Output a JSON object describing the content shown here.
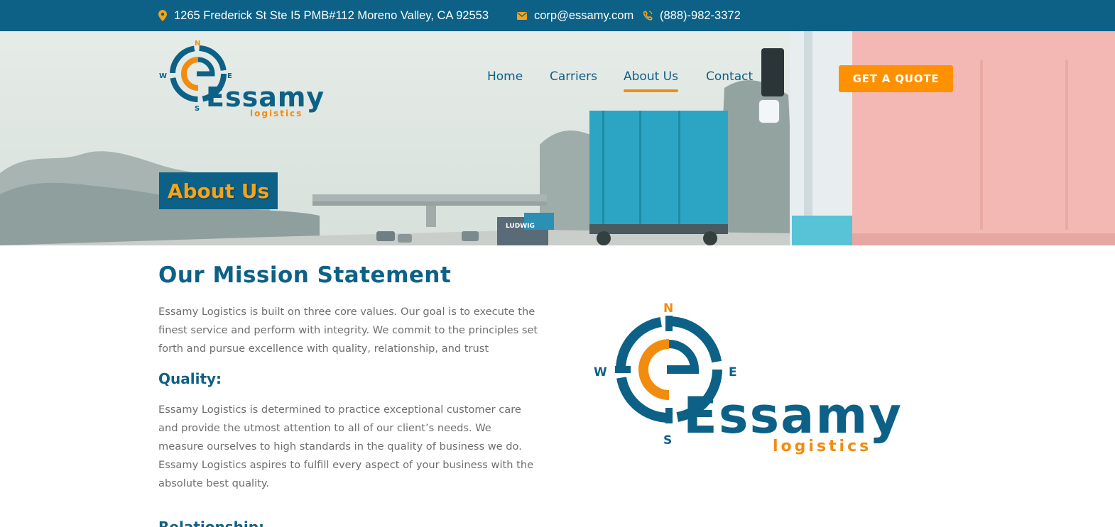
{
  "topbar": {
    "address": "1265 Frederick St Ste I5 PMB#112 Moreno Valley, CA 92553",
    "email": "corp@essamy.com",
    "phone": "(888)-982-3372",
    "icons": [
      "map-pin-icon",
      "envelope-icon",
      "phone-icon"
    ]
  },
  "logo": {
    "name": "Essamy",
    "tagline": "logistics",
    "compass": {
      "n": "N",
      "s": "S",
      "e": "E",
      "w": "W"
    }
  },
  "nav": {
    "items": [
      {
        "label": "Home",
        "active": false
      },
      {
        "label": "Carriers",
        "active": false
      },
      {
        "label": "About Us",
        "active": true
      },
      {
        "label": "Contact",
        "active": false
      }
    ],
    "cta": "GET A QUOTE"
  },
  "hero": {
    "title": "About Us",
    "truck_text": "LUDWIG"
  },
  "content": {
    "mission_title": "Our Mission Statement",
    "mission_text": "Essamy Logistics is built on three core values. Our goal is to execute the finest service and perform with integrity. We commit to the principles set forth and pursue excellence with quality, relationship, and trust",
    "quality_title": "Quality:",
    "quality_text": "Essamy Logistics is determined to practice exceptional customer care and provide the utmost attention to all of our client’s needs. We measure ourselves to high standards in the quality of business we do. Essamy Logistics aspires to fulfill every aspect of your business with the absolute best quality.",
    "relationship_title": "Relationship:"
  },
  "colors": {
    "brand_blue": "#0d6187",
    "brand_orange": "#f28c0f",
    "cta_orange": "#ff9000",
    "text_gray": "#6e6e6e"
  }
}
